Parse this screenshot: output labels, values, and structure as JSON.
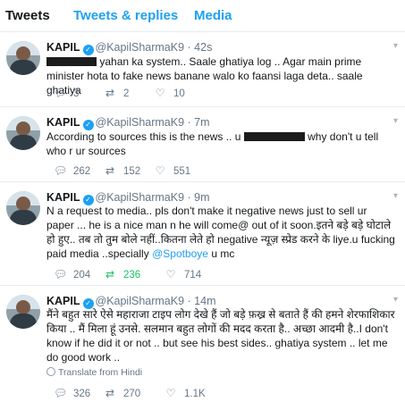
{
  "tabs": {
    "tweets": "Tweets",
    "replies": "Tweets & replies",
    "media": "Media"
  },
  "tweets": [
    {
      "name": "KAPIL",
      "handle": "@KapilSharmaK9",
      "time": "· 42s",
      "text_after_redact": "yahan ka system.. Saale ghatiya log .. Agar main prime minister hota to fake news banane walo ko faansi laga deta.. saale ghatiya",
      "replies": "3",
      "retweets": "2",
      "likes": "10"
    },
    {
      "name": "KAPIL",
      "handle": "@KapilSharmaK9",
      "time": "· 7m",
      "text_before_redact": "According to sources this is the news .. u",
      "text_after_redact": "why don't u tell who r ur sources",
      "replies": "262",
      "retweets": "152",
      "likes": "551"
    },
    {
      "name": "KAPIL",
      "handle": "@KapilSharmaK9",
      "time": "· 9m",
      "text": "N a request to media.. pls don't make it negative news just to sell ur paper ... he is a nice man n he will come@ out of it soon.इतने बड़े बड़े घोटाले हो हुए.. तब तो तुम बोले नहीं..कितना लेते हो negative न्यूज़ स्प्रेड करने के liye.u fucking paid media ..specially",
      "mention": "@Spotboye",
      "text_end": "u mc",
      "replies": "204",
      "retweets": "236",
      "likes": "714"
    },
    {
      "name": "KAPIL",
      "handle": "@KapilSharmaK9",
      "time": "· 14m",
      "text": "मैंने बहुत सारे ऐसे महाराजा टाइप लोग देखे हैं जो बड़े फ़ख्र से बताते हैं की हमने शेरफाशिकार किया .. मैं मिला हूं उनसे. सलमान बहुत लोगों की मदद करता है.. अच्छा आदमी है..I don't know if he did it or not .. but see his best sides.. ghatiya system .. let me do good work ..",
      "translate": "Translate from Hindi",
      "replies": "326",
      "retweets": "270",
      "likes": "1.1K"
    }
  ],
  "icons": {
    "reply": "reply-icon",
    "retweet": "retweet-icon",
    "like": "heart-icon",
    "verified": "verified-badge-icon",
    "caret": "chevron-down-icon"
  },
  "colors": {
    "accent": "#1da1f2",
    "retweet_on": "#17bf63",
    "muted": "#657786",
    "text": "#14171a"
  }
}
